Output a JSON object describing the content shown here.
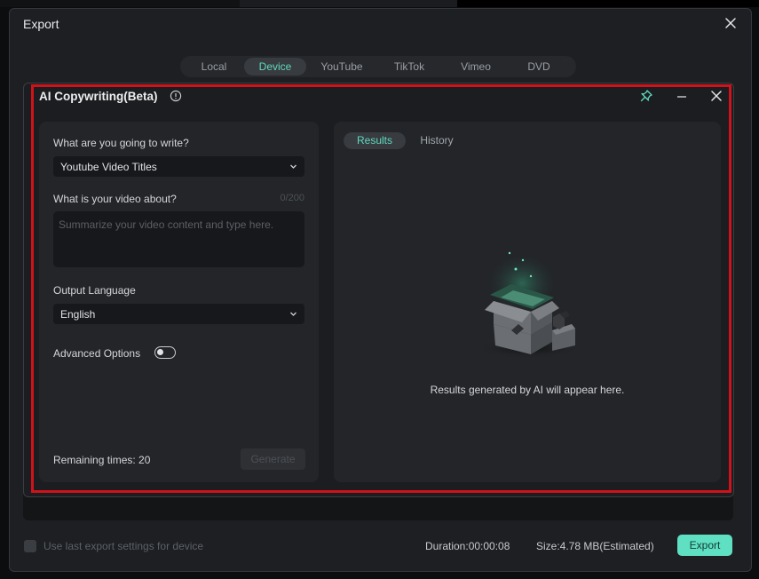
{
  "dialog": {
    "title": "Export",
    "tabs": [
      {
        "label": "Local",
        "active": false
      },
      {
        "label": "Device",
        "active": true
      },
      {
        "label": "YouTube",
        "active": false
      },
      {
        "label": "TikTok",
        "active": false
      },
      {
        "label": "Vimeo",
        "active": false
      },
      {
        "label": "DVD",
        "active": false
      }
    ]
  },
  "ai_panel": {
    "title": "AI Copywriting(Beta)",
    "write_label": "What are you going to write?",
    "write_value": "Youtube Video Titles",
    "about_label": "What is your video about?",
    "about_counter": "0/200",
    "about_placeholder": "Summarize your video content and type here.",
    "about_value": "",
    "language_label": "Output Language",
    "language_value": "English",
    "advanced_label": "Advanced Options",
    "advanced_enabled": false,
    "remaining_label": "Remaining times: 20",
    "generate_label": "Generate",
    "results_tab": "Results",
    "history_tab": "History",
    "empty_message": "Results generated by AI will appear here."
  },
  "footer": {
    "use_last_label": "Use last export settings for device",
    "use_last_checked": false,
    "duration": "Duration:00:00:08",
    "size": "Size:4.78 MB(Estimated)",
    "export_label": "Export"
  },
  "colors": {
    "accent": "#5fd9bd",
    "export_button": "#5fe0c2",
    "highlight_outline": "#d0121b"
  }
}
